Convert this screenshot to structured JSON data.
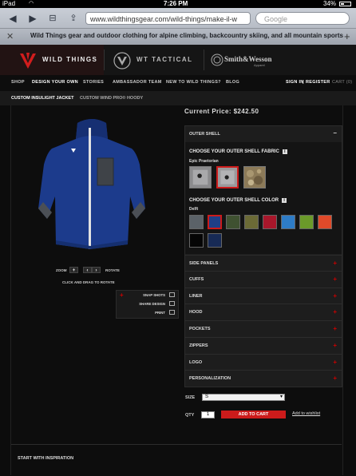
{
  "status_bar": {
    "device": "iPad",
    "time": "7:26 PM",
    "battery": "34%"
  },
  "browser": {
    "url": "www.wildthingsgear.com/wild-things/make-il-w",
    "search_placeholder": "Google",
    "tab_title": "Wild Things gear and outdoor clothing for alpine climbing, backcountry skiing, and all mountain sports",
    "tab_close": "✕",
    "tab_add": "+"
  },
  "brands": {
    "primary": "WILD THINGS",
    "secondary": "WT TACTICAL",
    "partner": "Smith&Wesson",
    "partner_sub": "Apparel"
  },
  "nav": {
    "items": [
      "SHOP",
      "DESIGN YOUR OWN",
      "STORIES",
      "AMBASSADOR TEAM",
      "NEW TO WILD THINGS?",
      "BLOG"
    ],
    "signin": "SIGN IN",
    "separator": "|",
    "register": "REGISTER",
    "cart": "CART (0)"
  },
  "subnav": {
    "items": [
      "CUSTOM INSULIGHT JACKET",
      "CUSTOM WIND PRO® HOODY"
    ]
  },
  "product": {
    "price_label": "Current Price:",
    "price": "$242.50"
  },
  "config": {
    "open_section": {
      "title": "OUTER SHELL",
      "toggle": "–"
    },
    "fabric_heading": "CHOOSE YOUR OUTER SHELL FABRIC",
    "fabric_selected": "Epic Praetorian",
    "color_heading": "CHOOSE YOUR OUTER SHELL COLOR",
    "color_selected": "Delft",
    "info_glyph": "i",
    "swatches": [
      "#5b6268",
      "#1f3f87",
      "#3f5131",
      "#6b6a36",
      "#a8172b",
      "#2e7cc6",
      "#6b9a2a",
      "#e04a2a",
      "#050505",
      "#172a55"
    ],
    "sections": [
      "SIDE PANELS",
      "CUFFS",
      "LINER",
      "HOOD",
      "POCKETS",
      "ZIPPERS",
      "LOGO",
      "PERSONALIZATION"
    ],
    "section_toggle": "+"
  },
  "viewer": {
    "zoom_label": "ZOOM",
    "zoom_in": "+",
    "prev": "‹",
    "next": "›",
    "rotate_label": "ROTATE",
    "drag_hint": "CLICK AND DRAG TO ROTATE",
    "actions": [
      "SNAP SHOTS",
      "SHARE DESIGN",
      "PRINT"
    ],
    "actions_toggle": "+"
  },
  "purchase": {
    "size_label": "SIZE",
    "size_value": "S",
    "size_arrow": "▾",
    "qty_label": "QTY",
    "qty_value": "1",
    "add_to_cart": "ADD TO CART",
    "wishlist": "Add to wishlist"
  },
  "footer": {
    "inspiration": "START WITH INSPIRATION"
  },
  "colors": {
    "accent": "#cc1b1b",
    "background": "#0d0d0d"
  }
}
